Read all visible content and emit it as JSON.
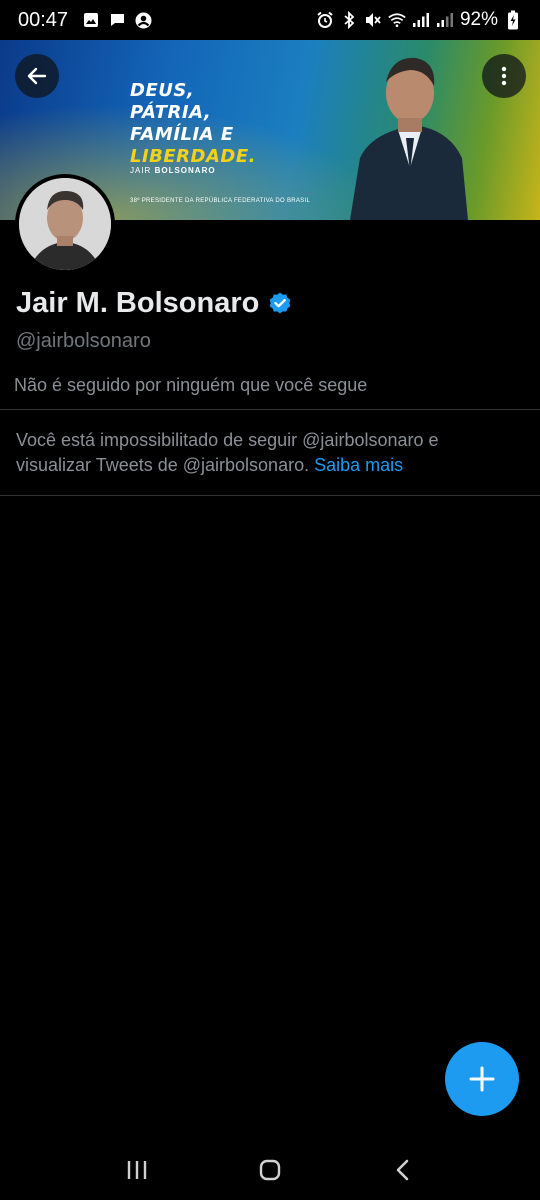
{
  "status_bar": {
    "time": "00:47",
    "battery": "92%",
    "icons_left": [
      "gallery-icon",
      "message-icon",
      "account-icon"
    ],
    "icons_right": [
      "alarm-icon",
      "bluetooth-icon",
      "mute-icon",
      "wifi-icon",
      "signal-icon",
      "signal-icon",
      "battery-icon"
    ]
  },
  "banner": {
    "line1": "DEUS,",
    "line2": "PÁTRIA,",
    "line3": "FAMÍLIA E",
    "line4": "LIBERDADE.",
    "name_prefix": "JAIR ",
    "name_bold": "BOLSONARO",
    "subtitle": "38º PRESIDENTE DA REPÚBLICA FEDERATIVA DO BRASIL",
    "colors": {
      "blue": "#1365b8",
      "yellow": "#f5d21a",
      "green": "#2a8a6a"
    }
  },
  "profile": {
    "name": "Jair M. Bolsonaro",
    "handle": "@jairbolsonaro",
    "followers_note": "Não é seguido por ninguém que você segue",
    "verified_color": "#1d9bf0"
  },
  "blocked_notice": {
    "text": "Você está impossibilitado de seguir @jairbolsonaro e visualizar Tweets de @jairbolsonaro. ",
    "link": "Saiba mais"
  },
  "colors": {
    "accent": "#1d9bf0",
    "background": "#000000",
    "text": "#e7e9ea",
    "muted": "#71767b"
  },
  "nav": {
    "items": [
      "recents-icon",
      "home-icon",
      "back-icon"
    ]
  }
}
